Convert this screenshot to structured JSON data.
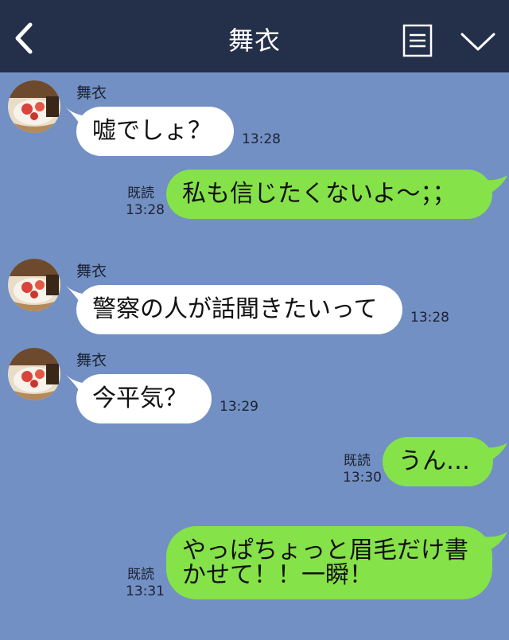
{
  "header": {
    "title": "舞衣",
    "back_icon": "chevron-left-icon",
    "menu_icon": "menu-icon",
    "dropdown_icon": "chevron-down-icon"
  },
  "messages": [
    {
      "sender": "舞衣",
      "text": "嘘でしょ？",
      "time": "13:28"
    },
    {
      "text": "私も信じたくないよ〜；；",
      "read": "既読",
      "time": "13:28"
    },
    {
      "sender": "舞衣",
      "text": "警察の人が話聞きたいって",
      "time": "13:28"
    },
    {
      "sender": "舞衣",
      "text": "今平気？",
      "time": "13:29"
    },
    {
      "text": "うん…",
      "read": "既読",
      "time": "13:30"
    },
    {
      "text_lines": [
        "やっぱちょっと眉毛だけ書",
        "かせて！！一瞬！"
      ],
      "read": "既読",
      "time": "13:31"
    }
  ],
  "colors": {
    "header_bg": "#243049",
    "chat_bg": "#7290c3",
    "incoming_bubble": "#ffffff",
    "outgoing_bubble": "#85e249"
  }
}
